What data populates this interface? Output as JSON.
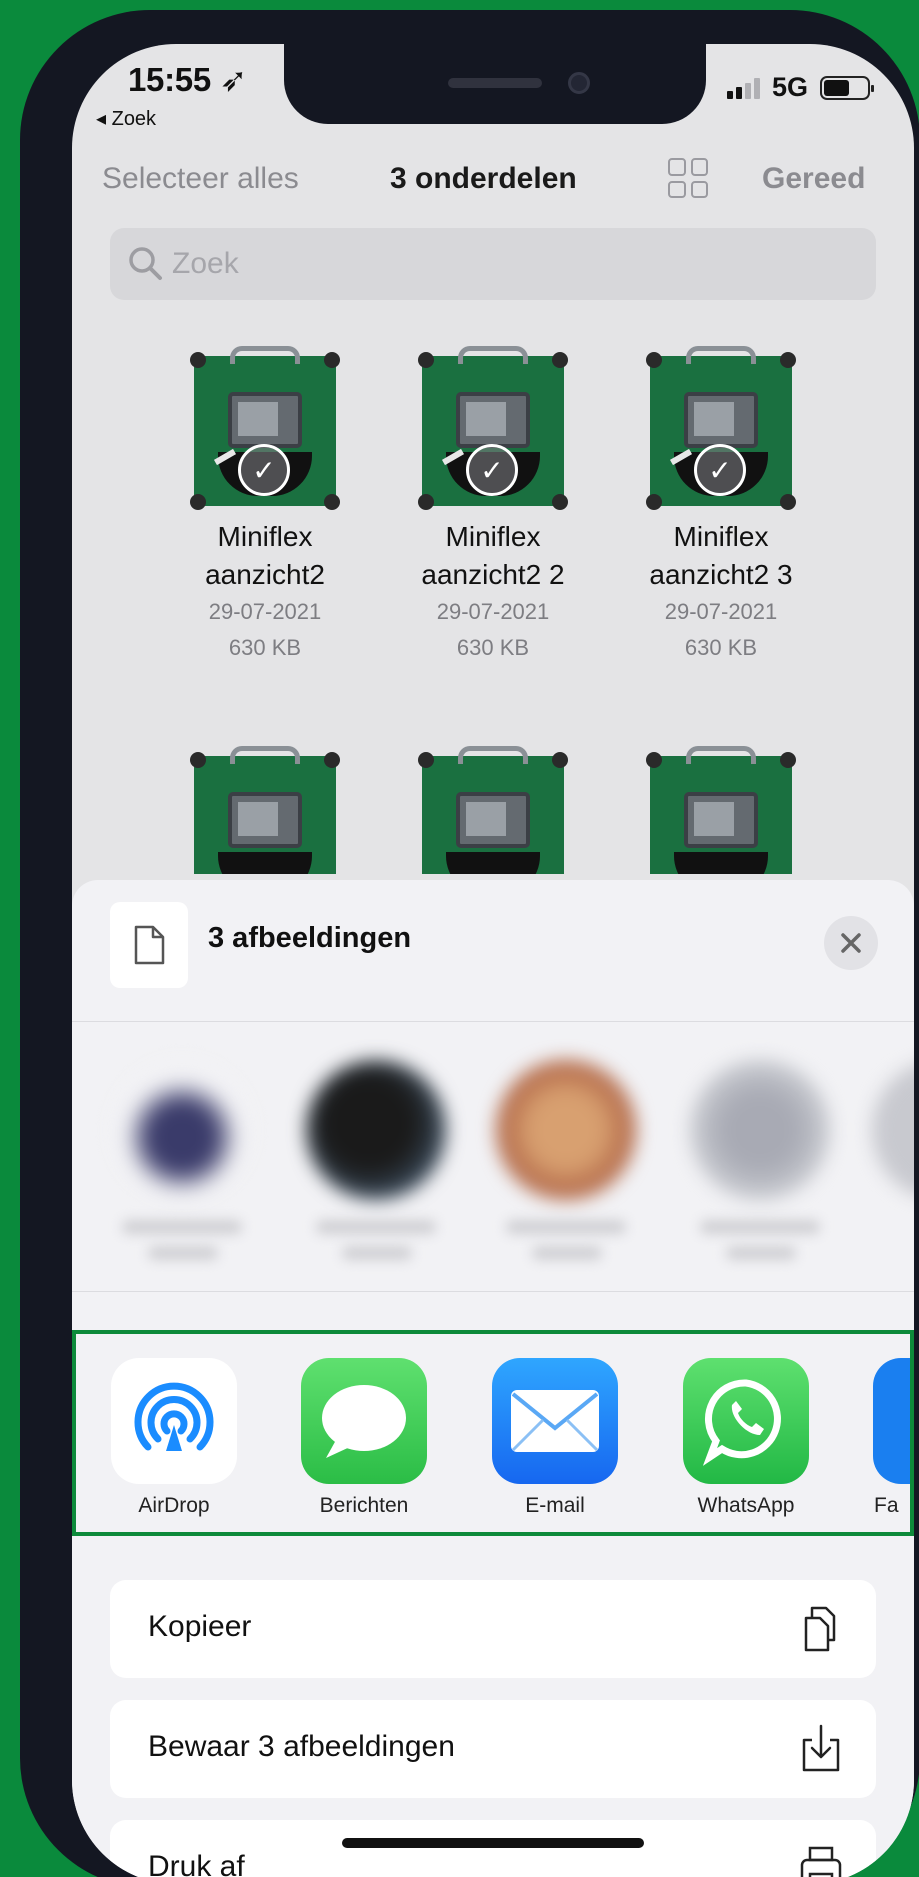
{
  "status_bar": {
    "time": "15:55 ➶",
    "back_label": "◂ Zoek",
    "network": "5G"
  },
  "header": {
    "select_all": "Selecteer alles",
    "title": "3 onderdelen",
    "done": "Gereed"
  },
  "search": {
    "placeholder": "Zoek"
  },
  "files": [
    {
      "name_line1": "Miniflex",
      "name_line2": "aanzicht2",
      "date": "29-07-2021",
      "size": "630 KB"
    },
    {
      "name_line1": "Miniflex",
      "name_line2": "aanzicht2 2",
      "date": "29-07-2021",
      "size": "630 KB"
    },
    {
      "name_line1": "Miniflex",
      "name_line2": "aanzicht2 3",
      "date": "29-07-2021",
      "size": "630 KB"
    }
  ],
  "share_sheet": {
    "title": "3 afbeeldingen",
    "apps": [
      {
        "label": "AirDrop",
        "icon": "airdrop-icon"
      },
      {
        "label": "Berichten",
        "icon": "messages-icon"
      },
      {
        "label": "E-mail",
        "icon": "mail-icon"
      },
      {
        "label": "WhatsApp",
        "icon": "whatsapp-icon"
      },
      {
        "label": "Fa",
        "icon": "app-icon"
      }
    ],
    "actions": [
      {
        "label": "Kopieer",
        "icon": "copy-icon"
      },
      {
        "label": "Bewaar 3 afbeeldingen",
        "icon": "save-icon"
      },
      {
        "label": "Druk af",
        "icon": "print-icon"
      }
    ]
  },
  "colors": {
    "background": "#0a8a3c",
    "highlight_border": "#0d8a3a",
    "messages": "#34c759",
    "mail": "#1a82fb",
    "whatsapp": "#25d366",
    "airdrop": "#1a8cff"
  }
}
